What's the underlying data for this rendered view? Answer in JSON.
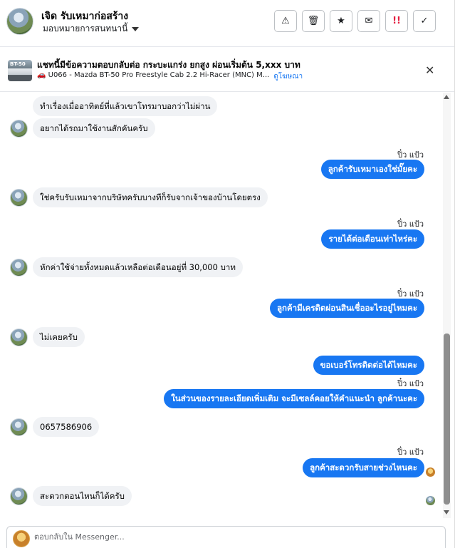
{
  "header": {
    "contact_name": "เจิด รับเหมาก่อสร้าง",
    "assign_label": "มอบหมายการสนทนานี้",
    "actions": [
      {
        "icon": "warning-icon",
        "glyph": "⚠"
      },
      {
        "icon": "trash-icon",
        "glyph": "🗑"
      },
      {
        "icon": "star-icon",
        "glyph": "★"
      },
      {
        "icon": "envelope-icon",
        "glyph": "✉"
      },
      {
        "icon": "priority-icon",
        "glyph": "!!"
      },
      {
        "icon": "check-icon",
        "glyph": "✓"
      }
    ]
  },
  "ad": {
    "thumb_text": "BT-50",
    "title": "แชทนี้มีข้อความตอบกลับต่อ กระบะแกร่ง ยกสูง ผ่อนเริ่มต้น 5,xxx บาท",
    "subtitle": "🚗 U066 - Mazda BT-50 Pro Freestyle Cab 2.2 Hi-Racer (MNC) M...",
    "link": "ดูโฆษณา",
    "close_icon": "✕"
  },
  "messages": {
    "m1": "ทำเรื่องเมื่ออาทิตย์ที่แล้วเขาโทรมาบอกว่าไม่ผ่าน",
    "m2": "อยากได้รถมาใช้งานสักคันครับ",
    "s1": "ปิ๋ว แป้ว",
    "o1": "ลูกค้ารับเหมาเองใช่มั๊ยคะ",
    "m3": "ใช่ครับรับเหมาจากบริษัทครับบางทีก็รับจากเจ้าของบ้านโดยตรง",
    "s2": "ปิ๋ว แป้ว",
    "o2": "รายได้ต่อเดือนเท่าไหร่คะ",
    "m4": "หักค่าใช้จ่ายทั้งหมดแล้วเหลือต่อเดือนอยู่ที่ 30,000 บาท",
    "s3": "ปิ๋ว แป้ว",
    "o3": "ลูกค้ามีเครดิตผ่อนสินเชื่ออะไรอยู่ไหมคะ",
    "m5": "ไม่เคยครับ",
    "o4": "ขอเบอร์โทรติดต่อได้ไหมคะ",
    "s4": "ปิ๋ว แป้ว",
    "o5": "ในส่วนของรายละเอียดเพิ่มเติม จะมีเซลล์คอยให้คำแนะนำ ลูกค้านะคะ",
    "m6": "0657586906",
    "s5": "ปิ๋ว แป้ว",
    "o6": "ลูกค้าสะดวกรับสายช่วงไหนคะ",
    "m7": "สะดวกตอนไหนก็ได้ครับ"
  },
  "composer": {
    "placeholder": "ตอบกลับใน Messenger..."
  }
}
